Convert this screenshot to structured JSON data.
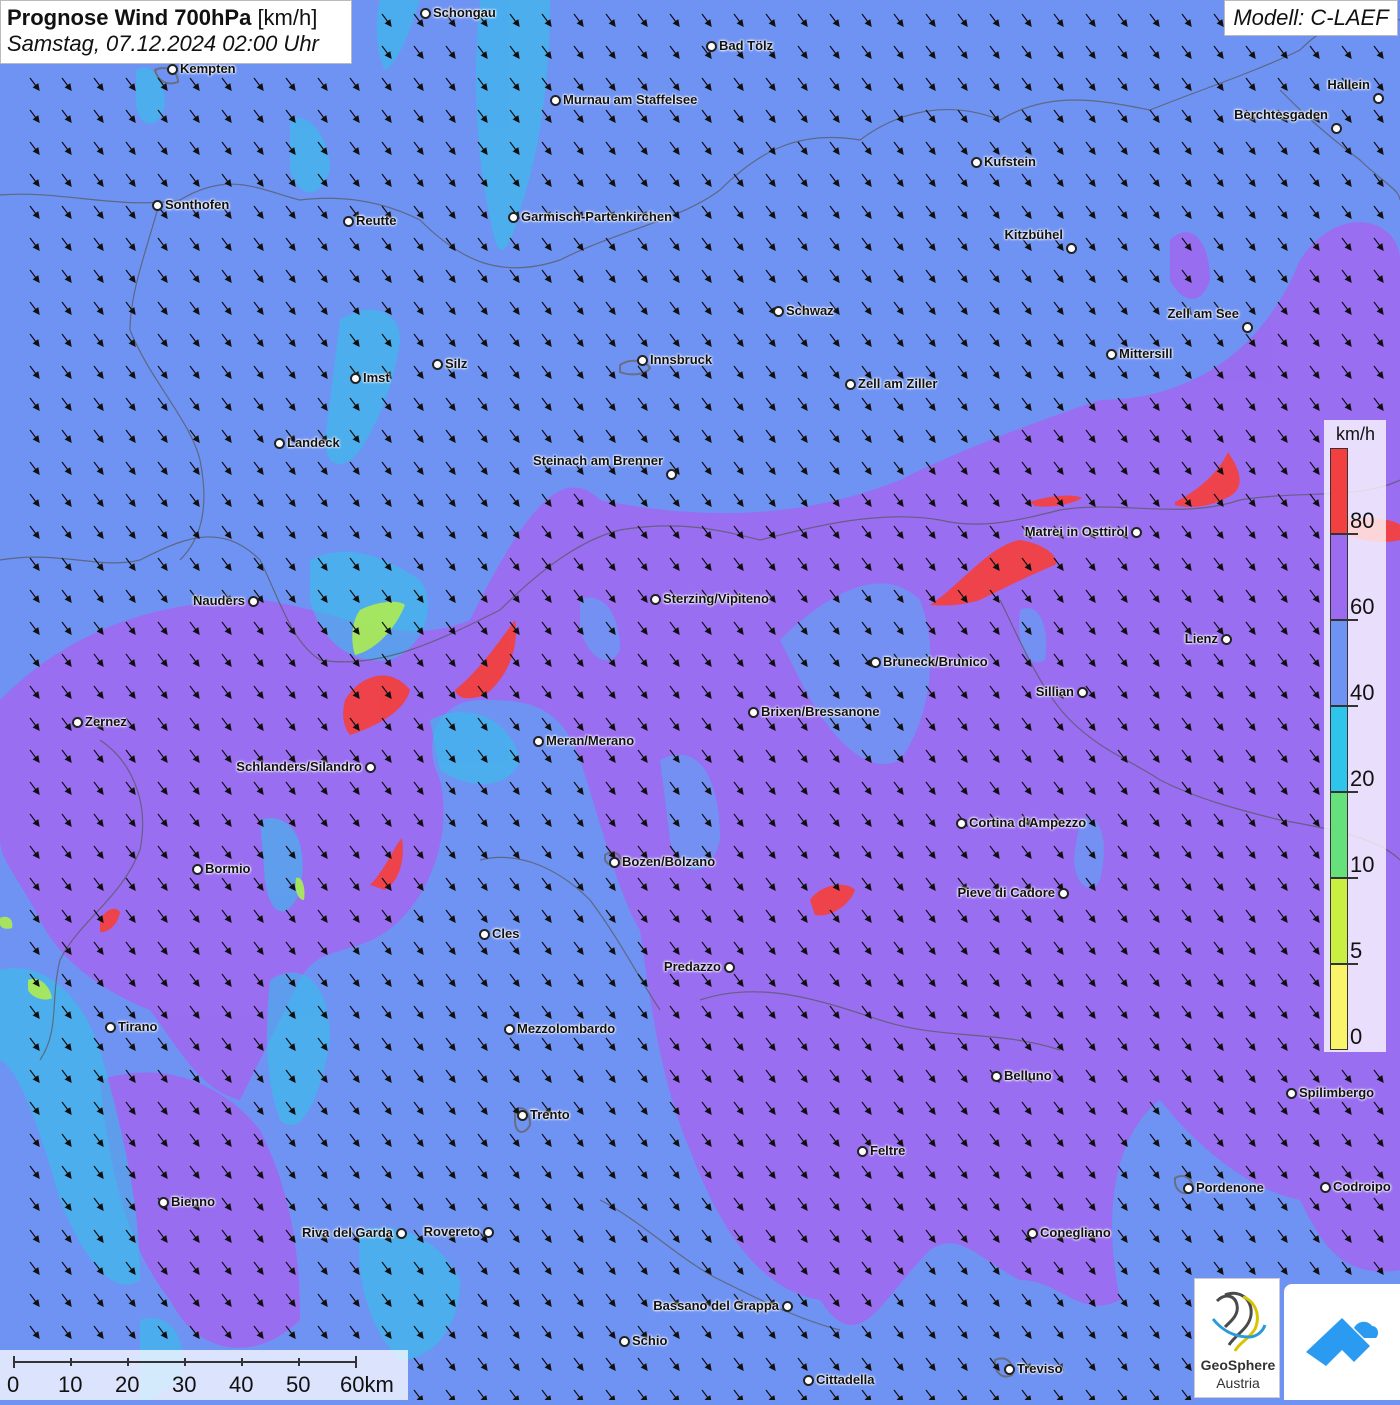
{
  "title": {
    "bold": "Prognose Wind 700hPa",
    "unit": "[km/h]",
    "datetime": "Samstag, 07.12.2024 02:00 Uhr"
  },
  "model": "Modell: C-LAEF",
  "legend": {
    "unit": "km/h",
    "labels": [
      "80",
      "60",
      "40",
      "20",
      "10",
      "5",
      "0"
    ],
    "colors": [
      "#f24040",
      "#9b6cf0",
      "#6f93f2",
      "#2fc4ea",
      "#66e07a",
      "#c8ef42",
      "#faf46a"
    ]
  },
  "scale_bar": {
    "labels": [
      "0",
      "10",
      "20",
      "30",
      "40",
      "50",
      "60km"
    ]
  },
  "logos": {
    "geosphere_line1": "GeoSphere",
    "geosphere_line2": "Austria"
  },
  "wind": {
    "direction": "north-west to south-east"
  },
  "cities": [
    {
      "name": "Schongau"
    },
    {
      "name": "Bad Tölz"
    },
    {
      "name": "Kempten"
    },
    {
      "name": "Murnau am Staffelsee"
    },
    {
      "name": "Hallein"
    },
    {
      "name": "Berchtesgaden"
    },
    {
      "name": "Kufstein"
    },
    {
      "name": "Sonthofen"
    },
    {
      "name": "Reutte"
    },
    {
      "name": "Garmisch-Partenkirchen"
    },
    {
      "name": "Kitzbühel"
    },
    {
      "name": "Schwaz"
    },
    {
      "name": "Zell am See"
    },
    {
      "name": "Innsbruck"
    },
    {
      "name": "Mittersill"
    },
    {
      "name": "Silz"
    },
    {
      "name": "Imst"
    },
    {
      "name": "Zell am Ziller"
    },
    {
      "name": "Landeck"
    },
    {
      "name": "Steinach am Brenner"
    },
    {
      "name": "Matrei in Osttirol"
    },
    {
      "name": "Nauders"
    },
    {
      "name": "Sterzing/Vipiteno"
    },
    {
      "name": "Lienz"
    },
    {
      "name": "Bruneck/Brunico"
    },
    {
      "name": "Sillian"
    },
    {
      "name": "Zernez"
    },
    {
      "name": "Brixen/Bressanone"
    },
    {
      "name": "Meran/Merano"
    },
    {
      "name": "Schlanders/Silandro"
    },
    {
      "name": "Cortina d'Ampezzo"
    },
    {
      "name": "Bozen/Bolzano"
    },
    {
      "name": "Bormio"
    },
    {
      "name": "Pieve di Cadore"
    },
    {
      "name": "Cles"
    },
    {
      "name": "Predazzo"
    },
    {
      "name": "Tirano"
    },
    {
      "name": "Mezzolombardo"
    },
    {
      "name": "Belluno"
    },
    {
      "name": "Spilimbergo"
    },
    {
      "name": "Trento"
    },
    {
      "name": "Feltre"
    },
    {
      "name": "Pordenone"
    },
    {
      "name": "Codroipo"
    },
    {
      "name": "Bienno"
    },
    {
      "name": "Riva del Garda"
    },
    {
      "name": "Rovereto"
    },
    {
      "name": "Conegliano"
    },
    {
      "name": "Bassano del Grappa"
    },
    {
      "name": "Schio"
    },
    {
      "name": "Treviso"
    },
    {
      "name": "Cittadella"
    }
  ]
}
